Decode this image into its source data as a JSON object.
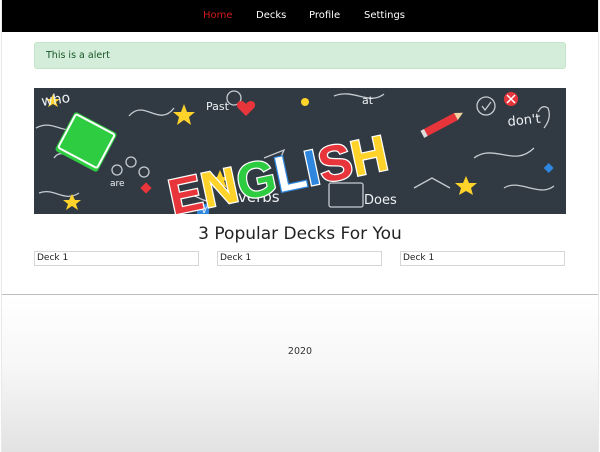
{
  "nav": {
    "items": [
      {
        "label": "Home",
        "active": true
      },
      {
        "label": "Decks",
        "active": false
      },
      {
        "label": "Profile",
        "active": false
      },
      {
        "label": "Settings",
        "active": false
      }
    ]
  },
  "alert": {
    "text": "This is a alert"
  },
  "banner": {
    "title": "ENGLISH",
    "doodle_words": [
      "who",
      "Past",
      "at",
      "don't",
      "are",
      "verbs",
      "Does",
      "V"
    ]
  },
  "popular": {
    "title": "3 Popular Decks For You",
    "decks": [
      {
        "label": "Deck 1"
      },
      {
        "label": "Deck 1"
      },
      {
        "label": "Deck 1"
      }
    ]
  },
  "footer": {
    "text": "2020"
  },
  "colors": {
    "nav_bg": "#000000",
    "nav_active": "#d01a1a",
    "alert_bg": "#d4edda",
    "alert_text": "#155724",
    "banner_bg": "#313a42"
  }
}
